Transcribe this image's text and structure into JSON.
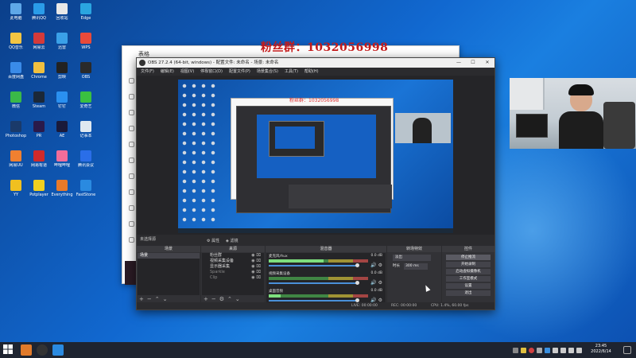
{
  "watermark": "粉丝群：1032056998",
  "desktop_icons": [
    {
      "label": "此电脑",
      "color": "#5fa8e8"
    },
    {
      "label": "腾讯QQ",
      "color": "#2a9ce8"
    },
    {
      "label": "回收站",
      "color": "#e8e8e8"
    },
    {
      "label": "Edge",
      "color": "#2aa5e0"
    },
    {
      "label": "QQ音乐",
      "color": "#f4c542"
    },
    {
      "label": "网易云",
      "color": "#d43a3a"
    },
    {
      "label": "迅雷",
      "color": "#3aa0e8"
    },
    {
      "label": "WPS",
      "color": "#e84a3a"
    },
    {
      "label": "百度网盘",
      "color": "#3a8be8"
    },
    {
      "label": "Chrome",
      "color": "#f0c040"
    },
    {
      "label": "剪映",
      "color": "#222"
    },
    {
      "label": "OBS",
      "color": "#2a2a2a"
    },
    {
      "label": "微信",
      "color": "#3ab848"
    },
    {
      "label": "Steam",
      "color": "#1b2838"
    },
    {
      "label": "钉钉",
      "color": "#2a90f0"
    },
    {
      "label": "爱奇艺",
      "color": "#3ac040"
    },
    {
      "label": "Photoshop",
      "color": "#1a3a6a"
    },
    {
      "label": "PR",
      "color": "#2a1a4a"
    },
    {
      "label": "AE",
      "color": "#1a1a3a"
    },
    {
      "label": "记事本",
      "color": "#dfe8f0"
    },
    {
      "label": "网易UU",
      "color": "#f08030"
    },
    {
      "label": "网易有道",
      "color": "#d02a2a"
    },
    {
      "label": "哔哩哔哩",
      "color": "#f26d9a"
    },
    {
      "label": "腾讯会议",
      "color": "#2a6ee8"
    },
    {
      "label": "YY",
      "color": "#f0c020"
    },
    {
      "label": "Potplayer",
      "color": "#f0d020"
    },
    {
      "label": "Everything",
      "color": "#e87a2a"
    },
    {
      "label": "FastStone",
      "color": "#2a8ae0"
    }
  ],
  "browser": {
    "title": "表格"
  },
  "obs": {
    "title": "OBS 27.2.4 (64-bit, windows) - 配置文件: 未命名 - 场景: 未命名",
    "menu": [
      "文件(F)",
      "编辑(E)",
      "视图(V)",
      "停靠窗口(D)",
      "配置文件(P)",
      "场景集合(S)",
      "工具(T)",
      "帮助(H)"
    ],
    "no_source_selected": "未选择源",
    "properties_btn": "属性",
    "filters_btn": "滤镜",
    "docks": {
      "scenes": "场景",
      "sources": "来源",
      "mixer": "混音器",
      "transitions": "转场特效",
      "controls": "控件"
    },
    "scenes": [
      "场景"
    ],
    "sources": [
      "粉丝群",
      "视频采集设备",
      "显示器采集",
      "Sparkle",
      "Clip"
    ],
    "mixer": [
      {
        "name": "麦克风/Aux",
        "db": "0.0 dB",
        "level": 0.55
      },
      {
        "name": "视频采集设备",
        "db": "0.0 dB",
        "level": 0.0
      },
      {
        "name": "桌面音频",
        "db": "0.0 dB",
        "level": 0.12
      }
    ],
    "transition": {
      "type": "淡出",
      "duration_label": "时长",
      "duration": "300 ms"
    },
    "controls": [
      "停止推流",
      "开始录制",
      "启动虚拟摄像机",
      "工作室模式",
      "设置",
      "退出"
    ],
    "status": {
      "live": "LIVE: 00:00:00",
      "rec": "REC: 00:00:00",
      "cpu": "CPU: 1.4%, 60.00 fps"
    }
  },
  "taskbar": {
    "time": "23:45",
    "date": "2022/6/14"
  }
}
